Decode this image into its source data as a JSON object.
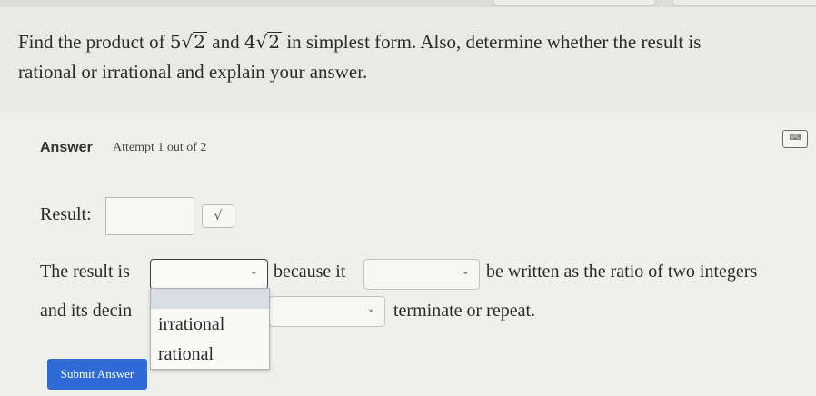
{
  "question": {
    "part1": "Find the product of ",
    "c1": "5",
    "r1": "2",
    "part2": " and ",
    "c2": "4",
    "r2": "2",
    "part3": " in simplest form. Also, determine whether the result is",
    "line2": "rational or irrational and explain your answer."
  },
  "answer": {
    "label": "Answer",
    "attempt": "Attempt 1 out of 2",
    "keyboard_icon": "keyboard-icon",
    "result_label": "Result:",
    "result_value": "",
    "sqrt_button": "√",
    "sentence1_prefix": "The result is",
    "sentence1_middle": "because it",
    "sentence1_suffix": "be written as the ratio of two integers",
    "sentence2_prefix": "and its decin",
    "sentence2_suffix": "terminate or repeat.",
    "dropdown_options": [
      "irrational",
      "rational"
    ],
    "submit": "Submit Answer"
  },
  "colors": {
    "submit_bg": "#2f6bd7",
    "menu_highlight": "#d7dde3"
  }
}
